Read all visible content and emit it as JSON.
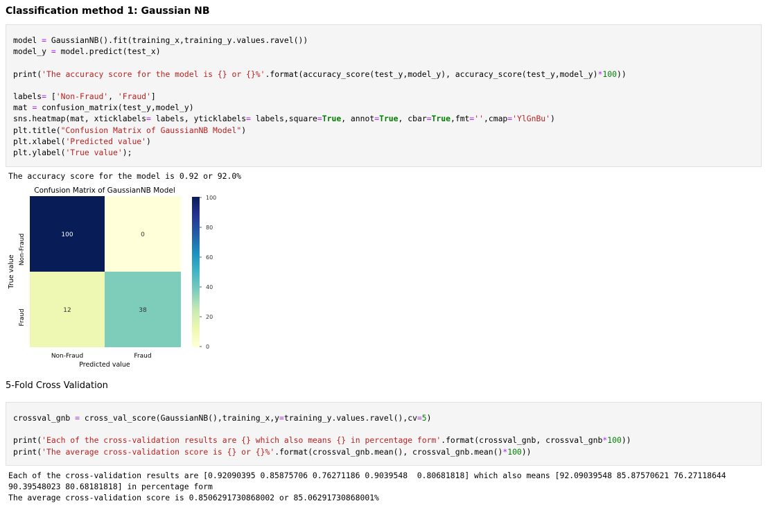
{
  "cell1": {
    "heading": "Classification method 1: Gaussian NB",
    "output_line": "The accuracy score for the model is 0.92 or 92.0%"
  },
  "heatmap": {
    "title": "Confusion Matrix of GaussianNB Model",
    "xlabel": "Predicted value",
    "ylabel": "True value",
    "row_labels": [
      "Non-Fraud",
      "Fraud"
    ],
    "col_labels": [
      "Non-Fraud",
      "Fraud"
    ],
    "colorbar_ticks": [
      "100",
      "80",
      "60",
      "40",
      "20",
      "0"
    ],
    "colors": {
      "100": "#081d58",
      "0": "#ffffd9",
      "12": "#eef8b2",
      "38": "#7ecdbb"
    }
  },
  "chart_data": {
    "type": "heatmap",
    "title": "Confusion Matrix of GaussianNB Model",
    "xlabel": "Predicted value",
    "ylabel": "True value",
    "x_categories": [
      "Non-Fraud",
      "Fraud"
    ],
    "y_categories": [
      "Non-Fraud",
      "Fraud"
    ],
    "values": [
      [
        100,
        0
      ],
      [
        12,
        38
      ]
    ],
    "colormap": "YlGnBu",
    "colorbar_range": [
      0,
      100
    ],
    "colorbar_ticks": [
      0,
      20,
      40,
      60,
      80,
      100
    ]
  },
  "cell2": {
    "heading": "5-Fold Cross Validation",
    "output_line1": "Each of the cross-validation results are [0.92090395 0.85875706 0.76271186 0.9039548  0.80681818] which also means [92.09039548 85.87570621 76.27118644",
    "output_line2": "90.39548023 80.68181818] in percentage form",
    "output_line3": "The average cross-validation score is 0.8506291730868002 or 85.06291730868001%"
  }
}
